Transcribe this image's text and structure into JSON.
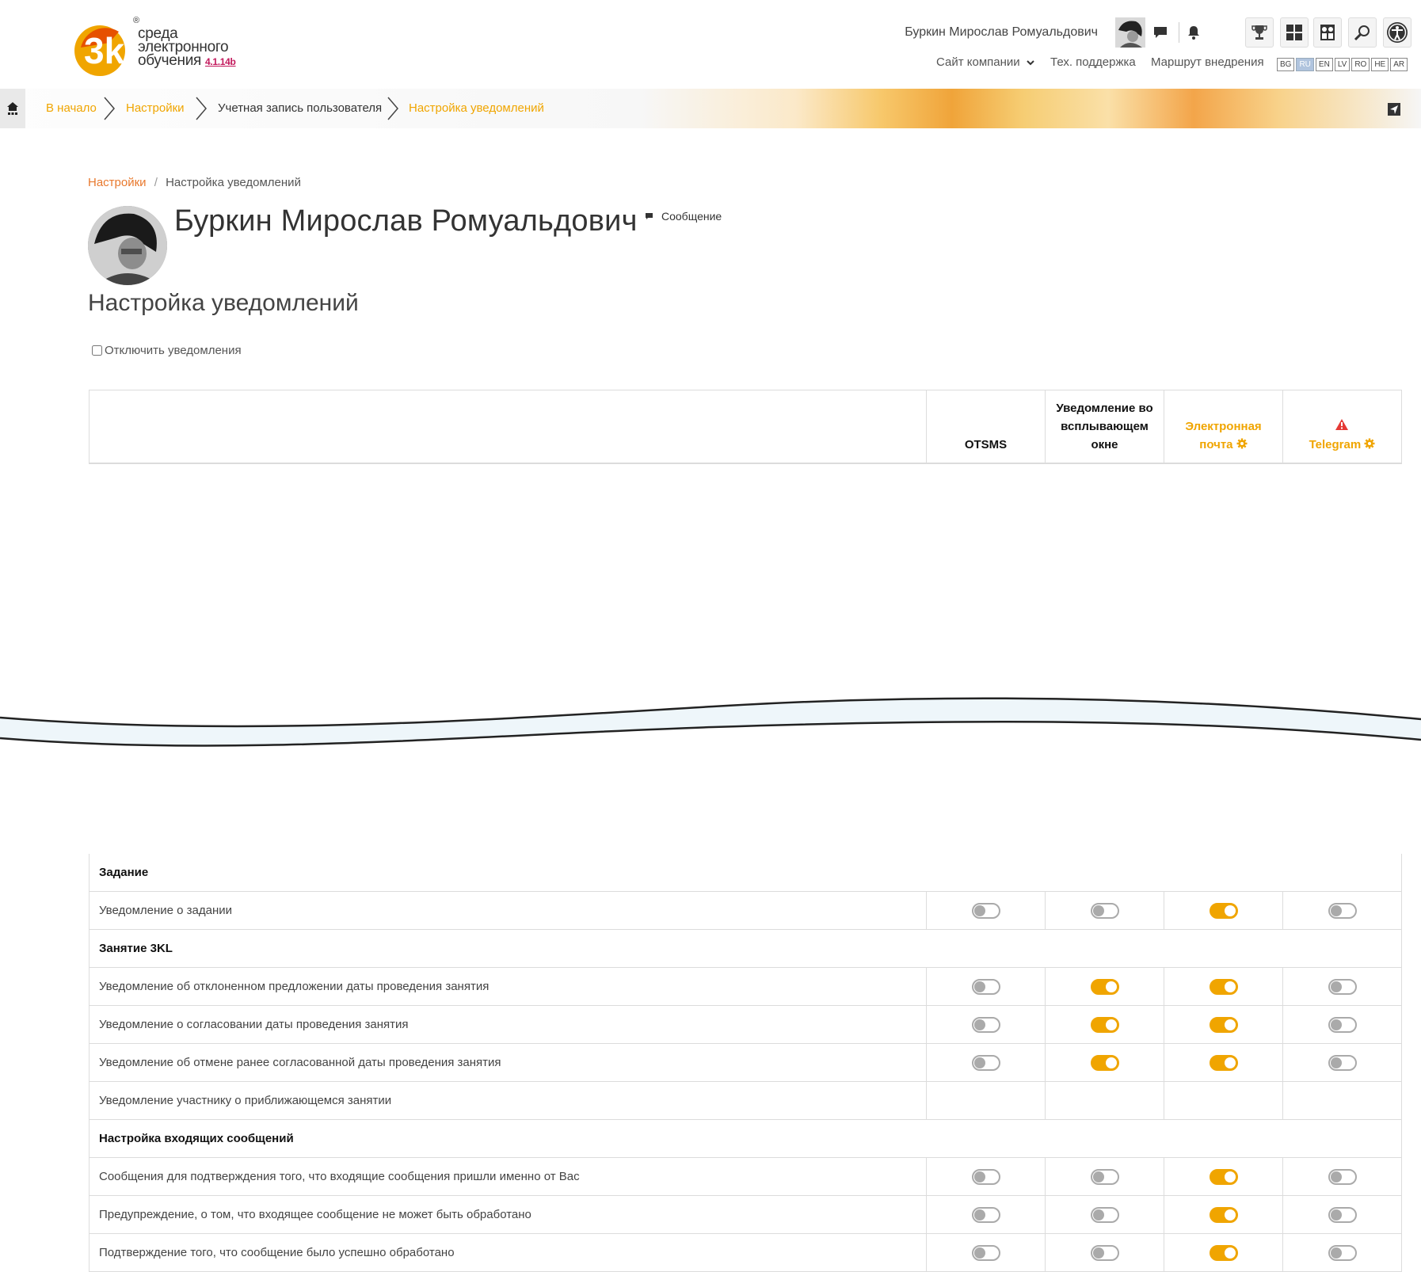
{
  "header": {
    "logo": {
      "line1": "среда",
      "line2": "электронного",
      "line3": "обучения",
      "version": "4.1.14b",
      "mark": "3k",
      "reg": "®"
    },
    "user_name": "Буркин Мирослав Ромуальдович",
    "links": {
      "company": "Сайт компании",
      "support": "Тех. поддержка",
      "route": "Маршрут внедрения"
    },
    "languages": [
      "BG",
      "RU",
      "EN",
      "LV",
      "RO",
      "HE",
      "AR"
    ],
    "active_language": "RU"
  },
  "breadcrumb": {
    "items": [
      "В начало",
      "Настройки",
      "Учетная запись пользователя",
      "Настройка уведомлений"
    ]
  },
  "page": {
    "breadcrumb2": {
      "link": "Настройки",
      "sep": "/",
      "current": "Настройка уведомлений"
    },
    "profile_name": "Буркин Мирослав Ромуальдович",
    "message_label": "Сообщение",
    "title": "Настройка уведомлений",
    "disable_label": "Отключить уведомления"
  },
  "table": {
    "columns": [
      {
        "l1": "",
        "l2": "",
        "l3": "OTSMS",
        "orange": false
      },
      {
        "l1": "Уведомление во",
        "l2": "всплывающем",
        "l3": "окне",
        "orange": false
      },
      {
        "l1": "",
        "l2": "Электронная",
        "l3": "почта",
        "orange": true,
        "gear": true
      },
      {
        "l1": "",
        "l2": "",
        "l3": "Telegram",
        "orange": true,
        "gear": true,
        "warning": true
      }
    ],
    "rows": [
      {
        "type": "group",
        "label": "Задание"
      },
      {
        "type": "item",
        "label": "Уведомление о задании",
        "toggles": [
          false,
          false,
          true,
          false
        ]
      },
      {
        "type": "group",
        "label": "Занятие 3KL"
      },
      {
        "type": "item",
        "label": "Уведомление об отклоненном предложении даты проведения занятия",
        "toggles": [
          false,
          true,
          true,
          false
        ]
      },
      {
        "type": "item",
        "label": "Уведомление о согласовании даты проведения занятия",
        "toggles": [
          false,
          true,
          true,
          false
        ]
      },
      {
        "type": "item",
        "label": "Уведомление об отмене ранее согласованной даты проведения занятия",
        "toggles": [
          false,
          true,
          true,
          false
        ]
      },
      {
        "type": "item",
        "label": "Уведомление участнику о приближающемся занятии",
        "toggles": [
          null,
          null,
          null,
          null
        ]
      },
      {
        "type": "group",
        "label": "Настройка входящих сообщений"
      },
      {
        "type": "item",
        "label": "Сообщения для подтверждения того, что входящие сообщения пришли именно от Вас",
        "toggles": [
          false,
          false,
          true,
          false
        ]
      },
      {
        "type": "item",
        "label": "Предупреждение, о том, что входящее сообщение не может быть обработано",
        "toggles": [
          false,
          false,
          true,
          false
        ]
      },
      {
        "type": "item",
        "label": "Подтверждение того, что сообщение было успешно обработано",
        "toggles": [
          false,
          false,
          true,
          false
        ]
      }
    ]
  },
  "colors": {
    "accent": "#f0a500",
    "link": "#e8792e",
    "warning": "#e53935"
  }
}
